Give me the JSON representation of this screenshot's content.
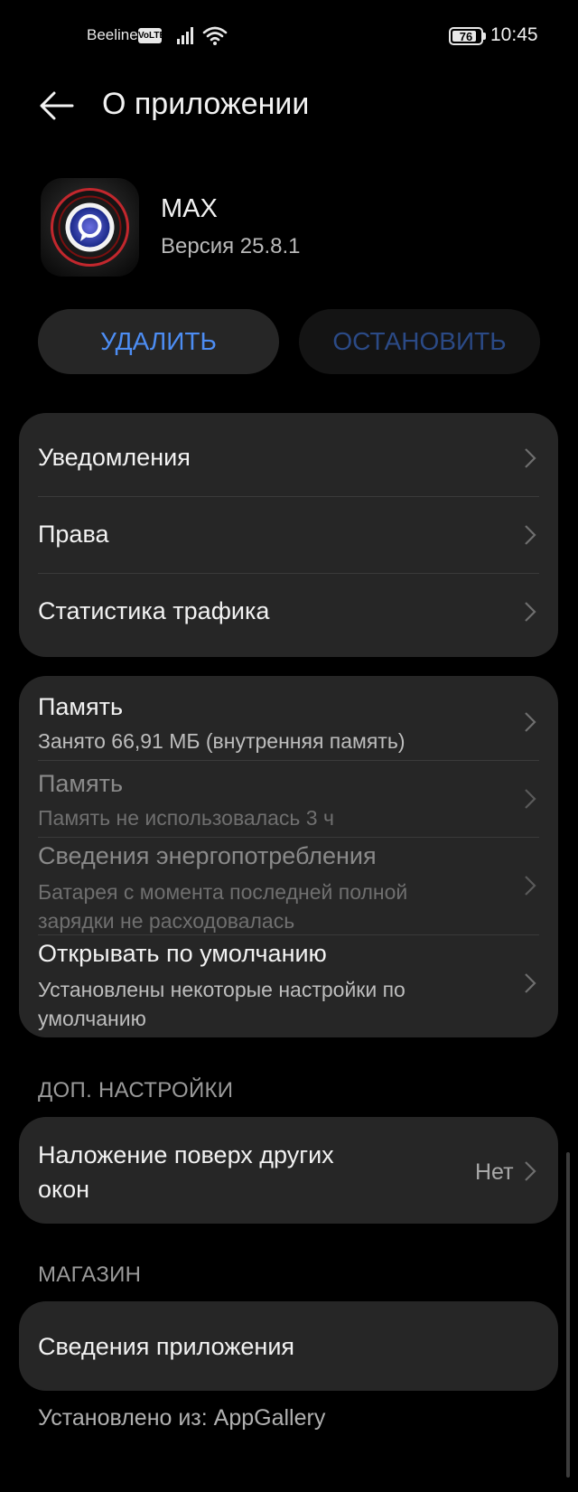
{
  "status_bar": {
    "carrier": "Beeline",
    "volte": "VoLTE",
    "battery": "76",
    "time": "10:45"
  },
  "header": {
    "title": "О приложении"
  },
  "app": {
    "name": "MAX",
    "version": "Версия 25.8.1"
  },
  "buttons": {
    "delete": "УДАЛИТЬ",
    "stop": "ОСТАНОВИТЬ"
  },
  "group1": {
    "notifications": "Уведомления",
    "permissions": "Права",
    "traffic": "Статистика трафика"
  },
  "group2": {
    "storage_title": "Память",
    "storage_sub": "Занято 66,91 МБ (внутренняя память)",
    "memory_title": "Память",
    "memory_sub": "Память не использовалась 3 ч",
    "power_title": "Сведения энергопотребления",
    "power_sub_1": "Батарея с момента последней полной",
    "power_sub_2": "зарядки не расходовалась",
    "default_title": "Открывать по умолчанию",
    "default_sub_1": "Установлены некоторые настройки по",
    "default_sub_2": "умолчанию"
  },
  "advanced": {
    "section": "ДОП. НАСТРОЙКИ",
    "overlay_title_1": "Наложение поверх других",
    "overlay_title_2": "окон",
    "overlay_value": "Нет"
  },
  "store": {
    "section": "МАГАЗИН",
    "app_details": "Сведения приложения",
    "installed_from": "Установлено из: AppGallery"
  },
  "colors": {
    "accent": "#4d8df3",
    "card_bg": "#262626",
    "background": "#000000"
  }
}
